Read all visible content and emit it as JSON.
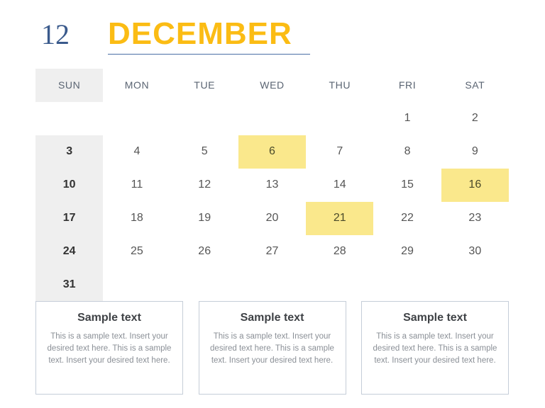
{
  "header": {
    "month_number": "12",
    "month_name": "DECEMBER",
    "accent_yellow": "#FBBC14",
    "accent_blue": "#3A5A8C",
    "underline_color": "#4A6FA5"
  },
  "calendar": {
    "weekday_headers": [
      "SUN",
      "MON",
      "TUE",
      "WED",
      "THU",
      "FRI",
      "SAT"
    ],
    "sunday_column_bg": "#EFEFEF",
    "highlight_bg": "#FAE88C",
    "weeks": [
      [
        "",
        "",
        "",
        "",
        "",
        "1",
        "2"
      ],
      [
        "3",
        "4",
        "5",
        "6",
        "7",
        "8",
        "9"
      ],
      [
        "10",
        "11",
        "12",
        "13",
        "14",
        "15",
        "16"
      ],
      [
        "17",
        "18",
        "19",
        "20",
        "21",
        "22",
        "23"
      ],
      [
        "24",
        "25",
        "26",
        "27",
        "28",
        "29",
        "30"
      ],
      [
        "31",
        "",
        "",
        "",
        "",
        "",
        ""
      ]
    ],
    "highlighted_days": [
      "6",
      "16",
      "21"
    ]
  },
  "cards": [
    {
      "title": "Sample text",
      "body": "This is a sample text. Insert your desired text here. This is a sample text. Insert your desired text here."
    },
    {
      "title": "Sample text",
      "body": "This is a sample text. Insert your desired text here. This is a sample text. Insert your desired text here."
    },
    {
      "title": "Sample text",
      "body": "This is a sample text. Insert your desired text here. This is a sample text. Insert your desired text here."
    }
  ]
}
